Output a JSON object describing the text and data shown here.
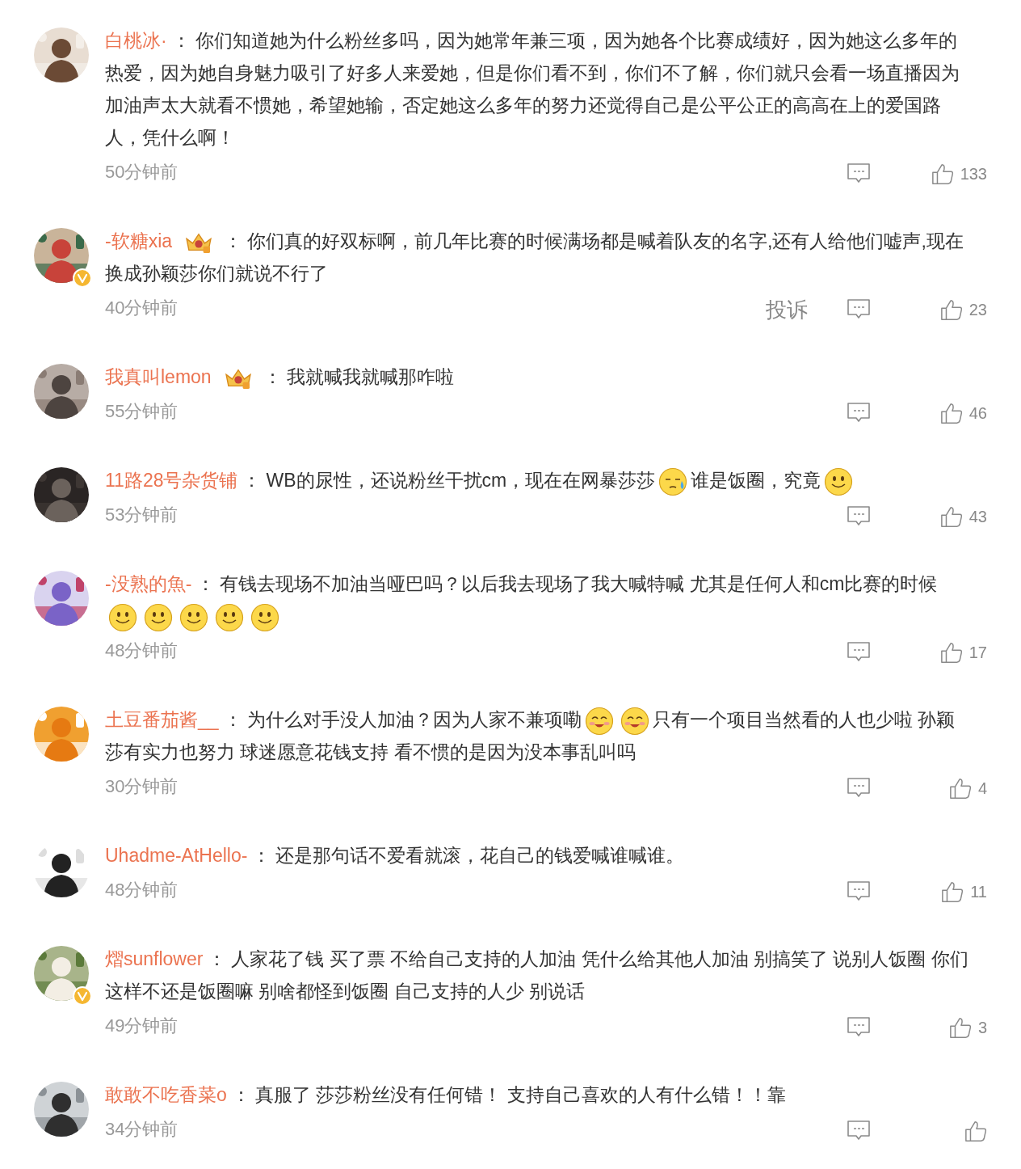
{
  "comments": [
    {
      "name": "白桃冰·",
      "member_badge": false,
      "verified": false,
      "separator": "：",
      "content": [
        {
          "kind": "text",
          "text": "你们知道她为什么粉丝多吗，因为她常年兼三项，因为她各个比赛成绩好，因为她这么多年的热爱，因为她自身魅力吸引了好多人来爱她，但是你们看不到，你们不了解，你们就只会看一场直播因为加油声太大就看不惯她，希望她输，否定她这么多年的努力还觉得自己是公平公正的高高在上的爱国路人，凭什么啊！"
        }
      ],
      "time": "50分钟前",
      "likes": "133"
    },
    {
      "name": "-软糖xia",
      "member_badge": true,
      "verified": true,
      "separator": "：",
      "content": [
        {
          "kind": "text",
          "text": "你们真的好双标啊，前几年比赛的时候满场都是喊着队友的名字,还有人给他们嘘声,现在换成孙颖莎你们就说不行了"
        }
      ],
      "time": "40分钟前",
      "report": "投诉",
      "likes": "23"
    },
    {
      "name": "我真叫lemon",
      "member_badge": true,
      "verified": false,
      "separator": "：",
      "content": [
        {
          "kind": "text",
          "text": "我就喊我就喊那咋啦"
        }
      ],
      "time": "55分钟前",
      "likes": "46"
    },
    {
      "name": "11路28号杂货铺",
      "member_badge": false,
      "verified": false,
      "separator": "：",
      "content": [
        {
          "kind": "text",
          "text": "WB的尿性，还说粉丝干扰cm，现在在网暴莎莎"
        },
        {
          "kind": "sweat"
        },
        {
          "kind": "text",
          "text": "谁是饭圈，究竟"
        },
        {
          "kind": "smile"
        }
      ],
      "time": "53分钟前",
      "likes": "43"
    },
    {
      "name": "-没熟的魚-",
      "member_badge": false,
      "verified": false,
      "separator": "：",
      "content": [
        {
          "kind": "text",
          "text": "有钱去现场不加油当哑巴吗？以后我去现场了我大喊特喊 尤其是任何人和cm比赛的时候"
        },
        {
          "kind": "break"
        },
        {
          "kind": "smile"
        },
        {
          "kind": "smile"
        },
        {
          "kind": "smile"
        },
        {
          "kind": "smile"
        },
        {
          "kind": "smile"
        }
      ],
      "time": "48分钟前",
      "likes": "17"
    },
    {
      "name": "土豆番茄酱__",
      "member_badge": false,
      "verified": false,
      "separator": "：",
      "content": [
        {
          "kind": "text",
          "text": "为什么对手没人加油？因为人家不兼项嘞"
        },
        {
          "kind": "blush"
        },
        {
          "kind": "blush"
        },
        {
          "kind": "text",
          "text": "只有一个项目当然看的人也少啦 孙颖莎有实力也努力 球迷愿意花钱支持 看不惯的是因为没本事乱叫吗"
        }
      ],
      "time": "30分钟前",
      "likes": "4"
    },
    {
      "name": "Uhadme-AtHello-",
      "member_badge": false,
      "verified": false,
      "separator": "：",
      "content": [
        {
          "kind": "text",
          "text": "还是那句话不爱看就滚，花自己的钱爱喊谁喊谁。"
        }
      ],
      "time": "48分钟前",
      "likes": "11"
    },
    {
      "name": "熠sunflower",
      "member_badge": false,
      "verified": true,
      "separator": "：",
      "content": [
        {
          "kind": "text",
          "text": "人家花了钱 买了票 不给自己支持的人加油 凭什么给其他人加油 别搞笑了 说别人饭圈 你们这样不还是饭圈嘛 别啥都怪到饭圈 自己支持的人少 别说话"
        }
      ],
      "time": "49分钟前",
      "likes": "3"
    },
    {
      "name": "敢敢不吃香菜o",
      "member_badge": false,
      "verified": false,
      "separator": "：",
      "content": [
        {
          "kind": "text",
          "text": "真服了 莎莎粉丝没有任何错！ 支持自己喜欢的人有什么错！！靠"
        }
      ],
      "time": "34分钟前"
    }
  ]
}
